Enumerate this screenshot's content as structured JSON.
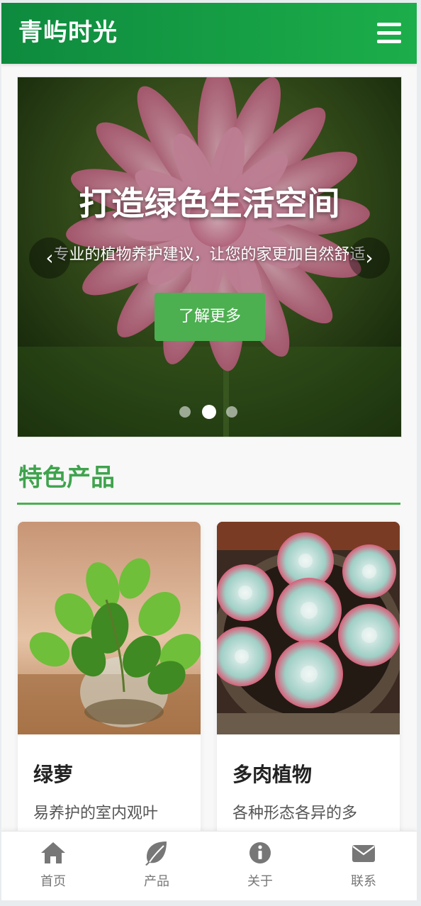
{
  "header": {
    "brand": "青屿时光",
    "menu_icon": "hamburger-menu-icon"
  },
  "hero": {
    "title": "打造绿色生活空间",
    "subtitle": "专业的植物养护建议，让您的家更加自然舒适",
    "cta_label": "了解更多",
    "prev_icon": "‹",
    "next_icon": "›",
    "slides_total": 3,
    "active_slide": 2
  },
  "featured": {
    "title": "特色产品",
    "products": [
      {
        "name": "绿萝",
        "description": "易养护的室内观叶"
      },
      {
        "name": "多肉植物",
        "description": "各种形态各异的多"
      }
    ]
  },
  "bottom_nav": {
    "items": [
      {
        "label": "首页",
        "icon": "home-icon"
      },
      {
        "label": "产品",
        "icon": "leaf-icon"
      },
      {
        "label": "关于",
        "icon": "info-icon"
      },
      {
        "label": "联系",
        "icon": "envelope-icon"
      }
    ]
  },
  "colors": {
    "header_start": "#0e8a3e",
    "header_end": "#1cae4a",
    "accent": "#4caf50",
    "section_title": "#3fa34d",
    "nav_text": "#777777"
  }
}
